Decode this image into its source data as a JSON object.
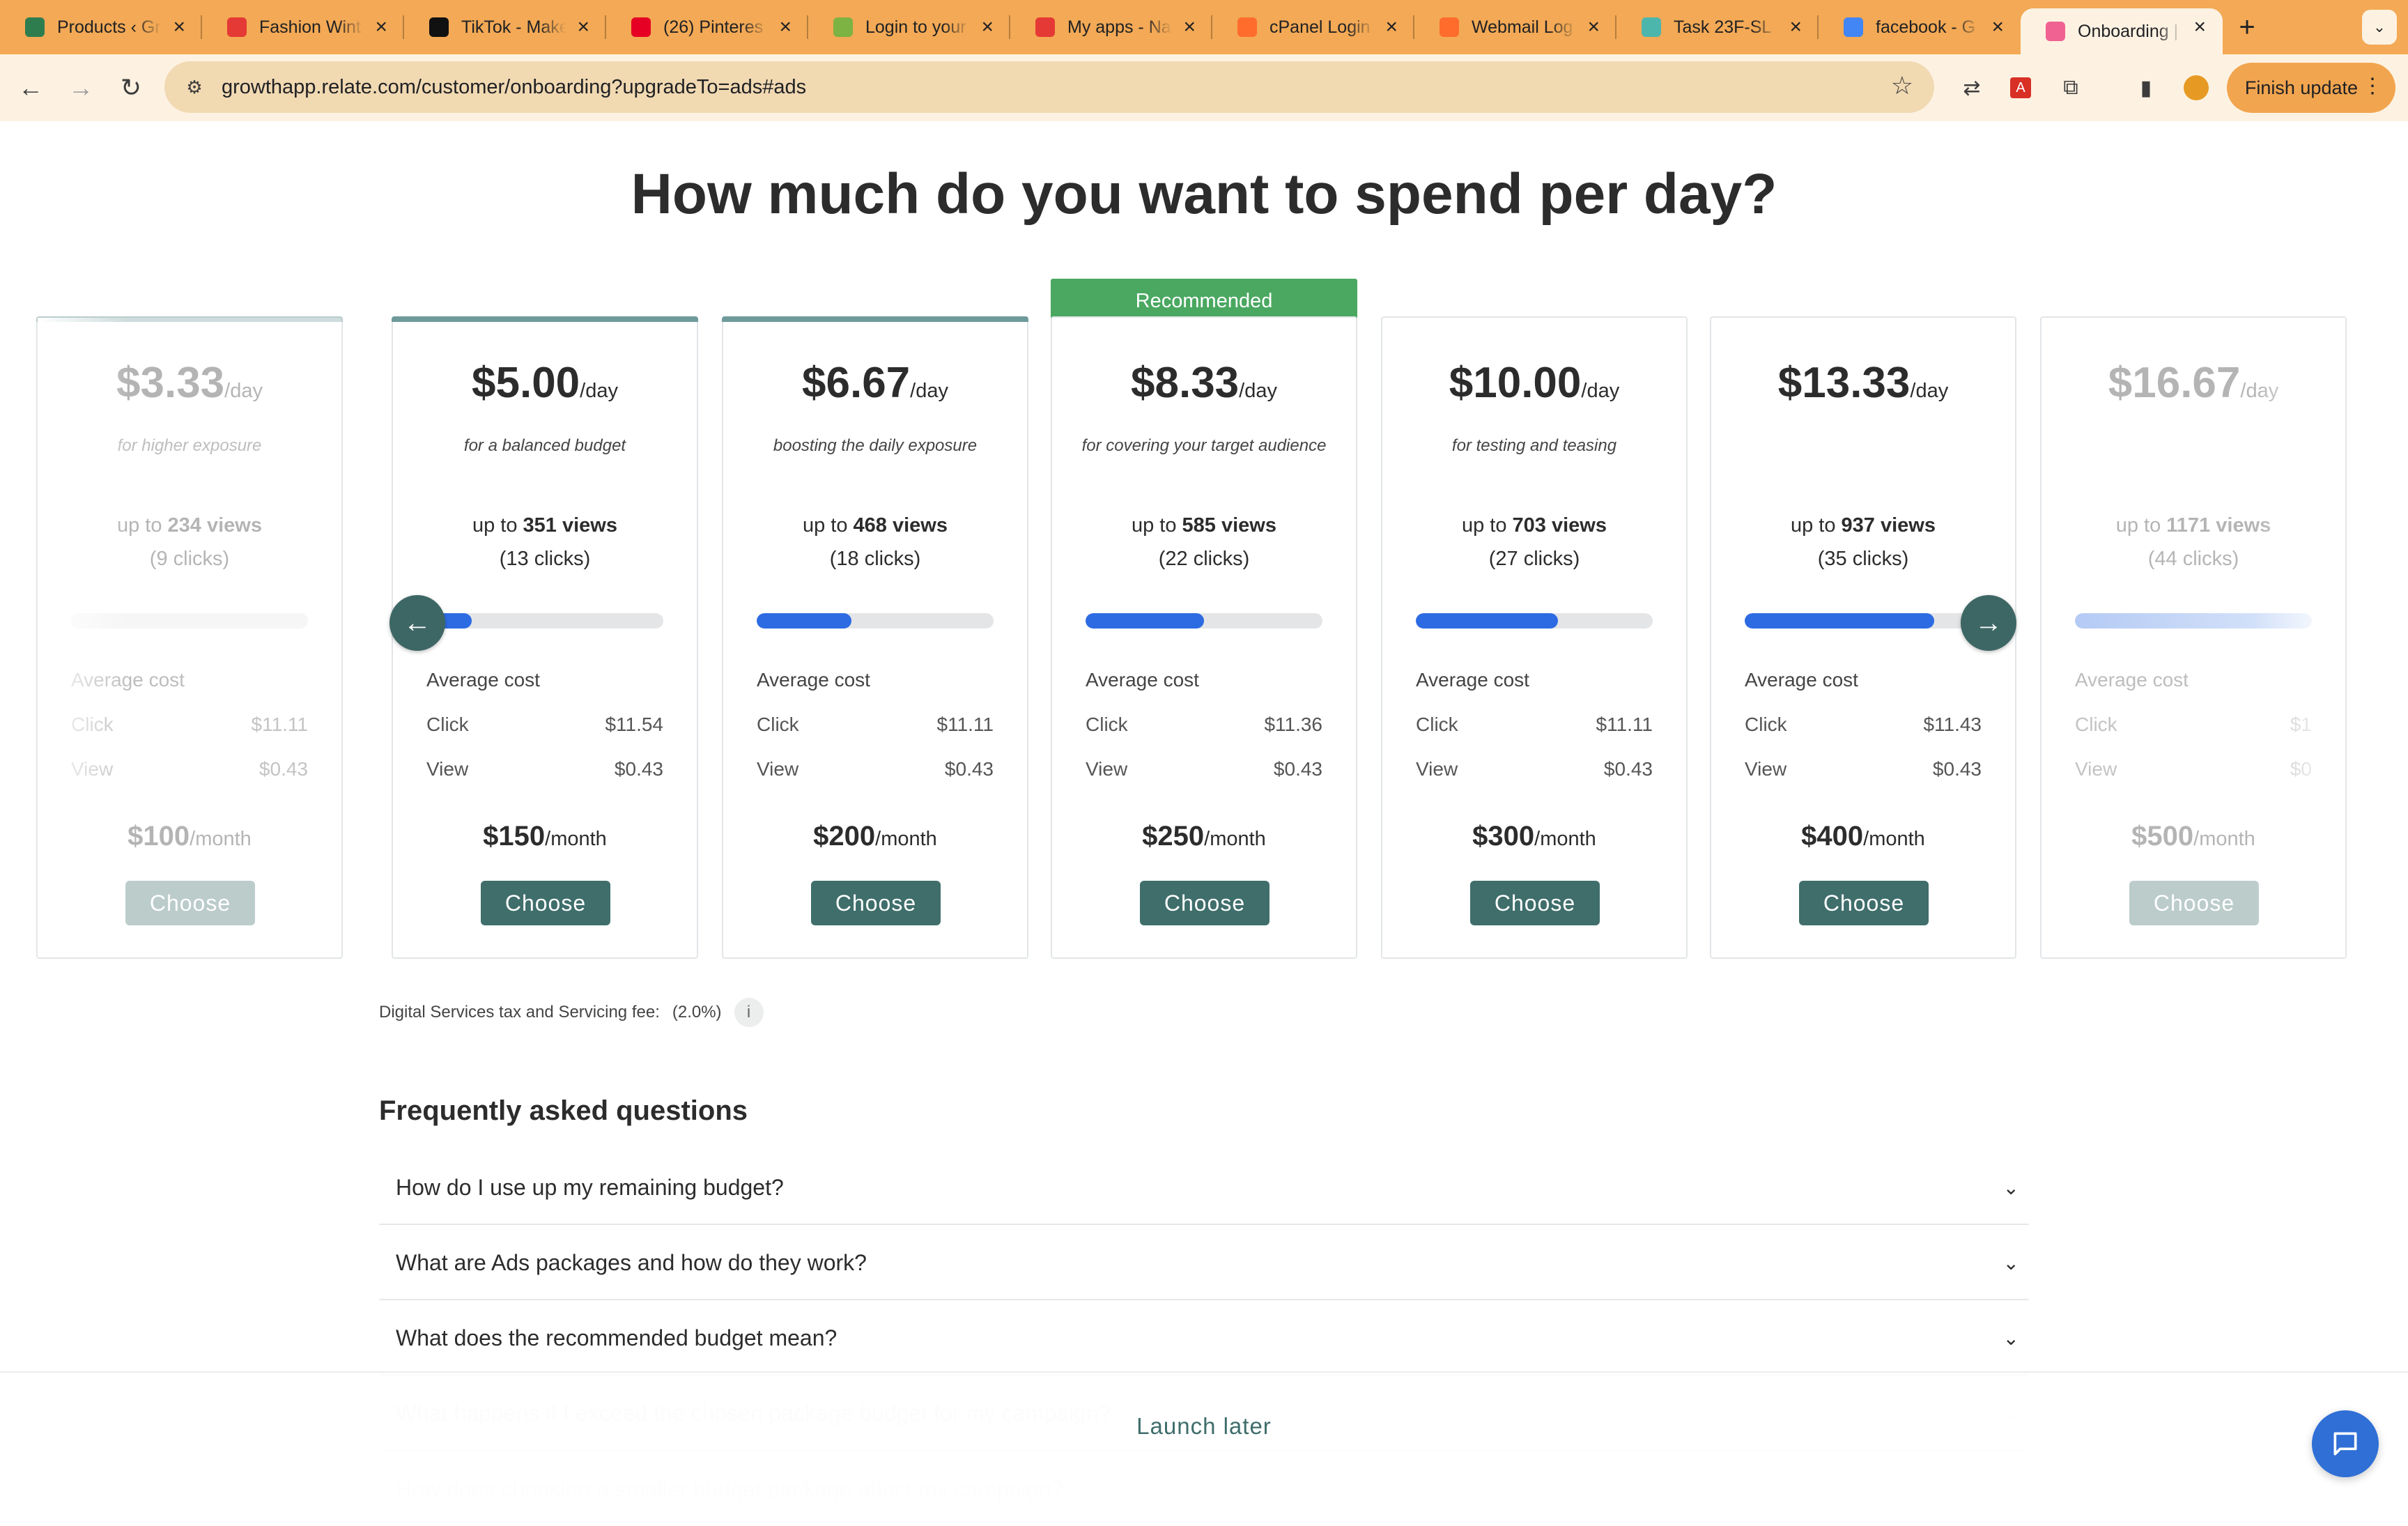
{
  "browser": {
    "tabs": [
      {
        "title": "Products ‹ Gr",
        "icon": "shop-icon",
        "color": "#2e7d4f"
      },
      {
        "title": "Fashion Wint",
        "icon": "mail-icon",
        "color": "#e53935"
      },
      {
        "title": "TikTok - Make",
        "icon": "tiktok-icon",
        "color": "#111111"
      },
      {
        "title": "(26) Pinteres",
        "icon": "pinterest-icon",
        "color": "#e60023"
      },
      {
        "title": "Login to your",
        "icon": "b-icon",
        "color": "#7cb342"
      },
      {
        "title": "My apps - Na",
        "icon": "apps-icon",
        "color": "#e53935"
      },
      {
        "title": "cPanel Login",
        "icon": "cpanel-icon",
        "color": "#ff6c2c"
      },
      {
        "title": "Webmail Log",
        "icon": "cpanel-icon",
        "color": "#ff6c2c"
      },
      {
        "title": "Task 23F-SL",
        "icon": "globe-icon",
        "color": "#4db6ac"
      },
      {
        "title": "facebook - G",
        "icon": "google-icon",
        "color": "#4285f4"
      },
      {
        "title": "Onboarding |",
        "icon": "flower-icon",
        "color": "#f06292"
      }
    ],
    "url": "growthapp.relate.com/customer/onboarding?upgradeTo=ads#ads",
    "finish_update": "Finish update"
  },
  "page": {
    "title": "How much do you want to spend per day?",
    "recommended_label": "Recommended",
    "per_day": "/day",
    "per_month": "/month",
    "avg_cost_label": "Average cost",
    "click_label": "Click",
    "view_label": "View",
    "choose_label": "Choose",
    "packages": [
      {
        "price": "$3.33",
        "subtitle": "for higher exposure",
        "views_prefix": "up to ",
        "views": "234 views",
        "clicks": "(9 clicks)",
        "fill": 0.0,
        "click_cost": "$11.11",
        "view_cost": "$0.43",
        "monthly": "$100"
      },
      {
        "price": "$5.00",
        "subtitle": "for a balanced budget",
        "views_prefix": "up to ",
        "views": "351 views",
        "clicks": "(13 clicks)",
        "fill": 0.19,
        "click_cost": "$11.54",
        "view_cost": "$0.43",
        "monthly": "$150"
      },
      {
        "price": "$6.67",
        "subtitle": "boosting the daily exposure",
        "views_prefix": "up to ",
        "views": "468 views",
        "clicks": "(18 clicks)",
        "fill": 0.4,
        "click_cost": "$11.11",
        "view_cost": "$0.43",
        "monthly": "$200"
      },
      {
        "price": "$8.33",
        "subtitle": "for covering your target audience",
        "views_prefix": "up to ",
        "views": "585 views",
        "clicks": "(22 clicks)",
        "fill": 0.5,
        "click_cost": "$11.36",
        "view_cost": "$0.43",
        "monthly": "$250"
      },
      {
        "price": "$10.00",
        "subtitle": "for testing and teasing",
        "views_prefix": "up to ",
        "views": "703 views",
        "clicks": "(27 clicks)",
        "fill": 0.6,
        "click_cost": "$11.11",
        "view_cost": "$0.43",
        "monthly": "$300"
      },
      {
        "price": "$13.33",
        "subtitle": "",
        "views_prefix": "up to ",
        "views": "937 views",
        "clicks": "(35 clicks)",
        "fill": 0.8,
        "click_cost": "$11.43",
        "view_cost": "$0.43",
        "monthly": "$400"
      },
      {
        "price": "$16.67",
        "subtitle": "",
        "views_prefix": "up to ",
        "views": "1171 views",
        "clicks": "(44 clicks)",
        "fill": 1.0,
        "click_cost": "$1",
        "view_cost": "$0",
        "monthly": "$500"
      }
    ],
    "fee_label": "Digital Services tax and Servicing fee:",
    "fee_value": "(2.0%)",
    "faq_title": "Frequently asked questions",
    "faq": [
      "How do I use up my remaining budget?",
      "What are Ads packages and how do they work?",
      "What does the recommended budget mean?",
      "What happens if I exceed the chosen package budget for my campaign?",
      "How does choosing a smaller budget package affect my campaign?"
    ],
    "launch_later": "Launch later"
  },
  "colors": {
    "accent": "#3f6e6b",
    "recommended": "#4aa861",
    "progress": "#2d6be3",
    "chrome": "#f3a955"
  }
}
